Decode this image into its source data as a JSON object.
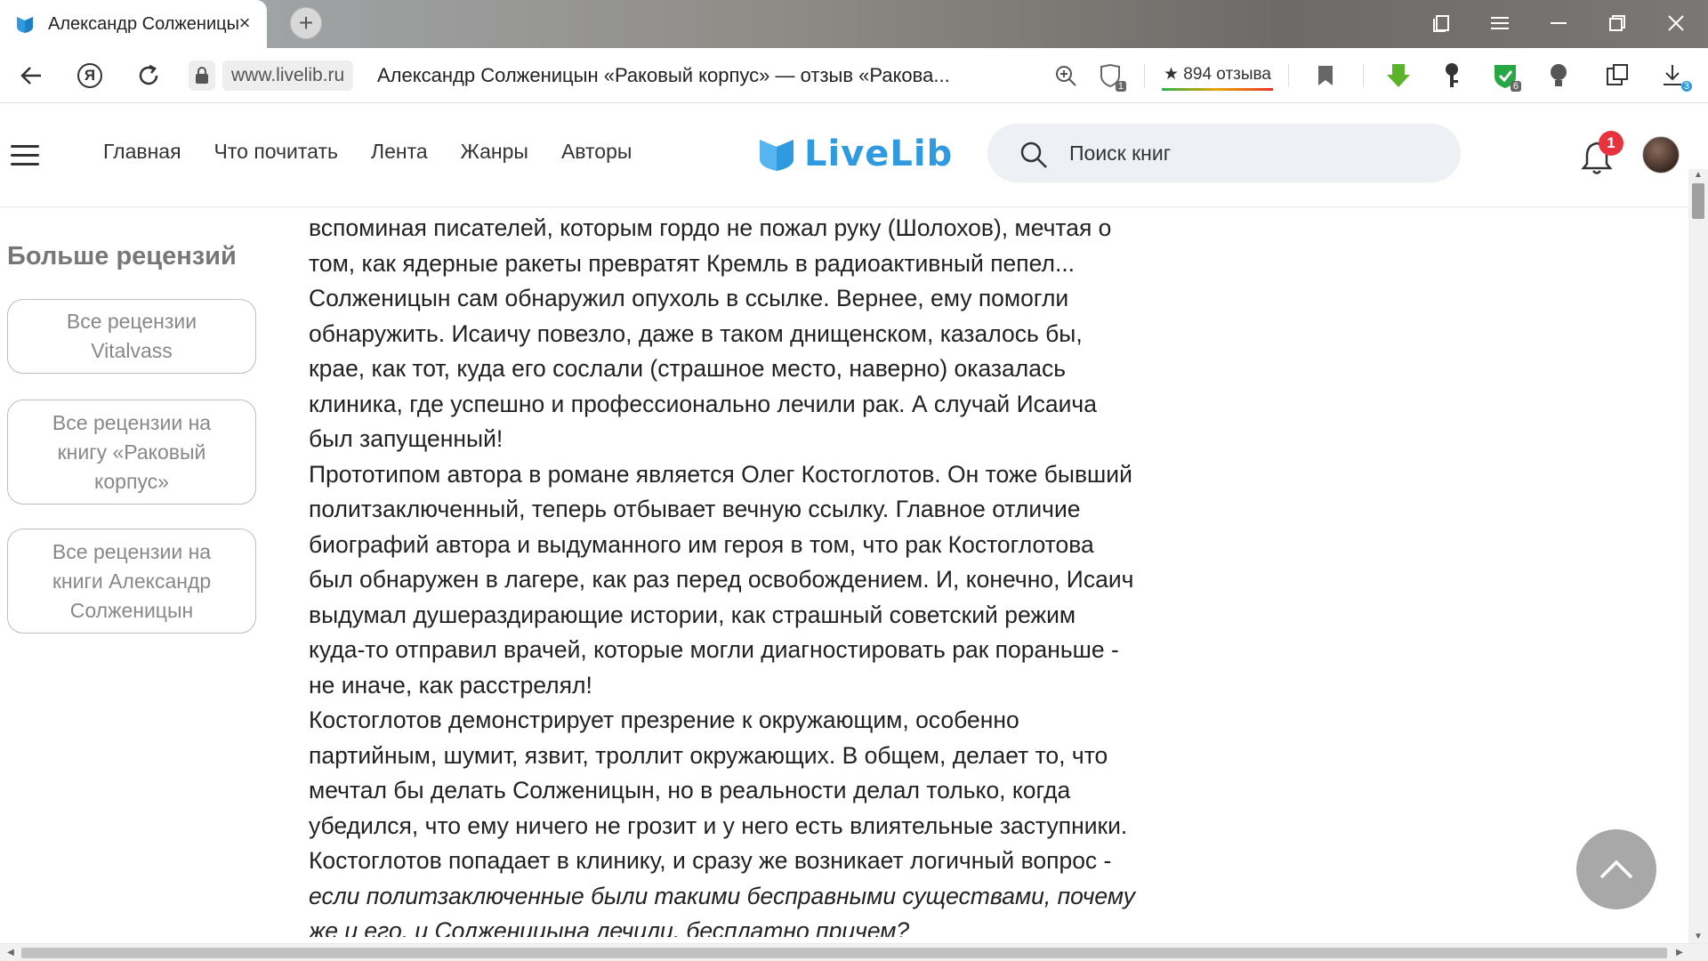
{
  "browser": {
    "tab_title": "Александр Солженицын",
    "tab_close": "×",
    "new_tab": "+",
    "url_domain": "www.livelib.ru",
    "url_title": "Александр Солженицын «Раковый корпус» — отзыв «Ракова...",
    "reviews_chip": "★ 894 отзыва",
    "ext_badge_1": "1",
    "ext_badge_6": "6",
    "ext_badge_3": "3",
    "yandex_label": "Я"
  },
  "site": {
    "nav": [
      "Главная",
      "Что почитать",
      "Лента",
      "Жанры",
      "Авторы"
    ],
    "logo_text": "LiveLib",
    "search_placeholder": "Поиск книг",
    "notifications_count": "1",
    "accent": "#2f9ae0",
    "badge_color": "#e8323e"
  },
  "sidebar": {
    "title": "Больше рецензий",
    "buttons": [
      "Все рецензии Vitalvass",
      "Все рецензии на книгу «Раковый корпус»",
      "Все рецензии на книги Александр Солженицын"
    ]
  },
  "article": {
    "lines": [
      "вспоминая писателей, которым гордо не пожал руку (Шолохов), мечтая о",
      "том, как ядерные ракеты превратят Кремль в радиоактивный пепел...",
      "Солженицын сам обнаружил опухоль в ссылке. Вернее, ему помогли",
      "обнаружить. Исаичу повезло, даже в таком днищенском, казалось бы,",
      "крае, как тот, куда его сослали (страшное место, наверно) оказалась",
      "клиника, где успешно и профессионально лечили рак. А случай Исаича",
      "был запущенный!",
      "Прототипом автора в романе является Олег Костоглотов. Он тоже бывший",
      "политзаключенный, теперь отбывает вечную ссылку. Главное отличие",
      "биографий автора и выдуманного им героя в том, что рак Костоглотова",
      "был обнаружен в лагере, как раз перед освобождением. И, конечно, Исаич",
      "выдумал душераздирающие истории, как страшный советский режим",
      "куда-то отправил врачей, которые могли диагностировать рак пораньше -",
      "не иначе, как расстрелял!",
      "Костоглотов демонстрирует презрение к окружающим, особенно",
      "партийным, шумит, язвит, троллит окружающих. В общем, делает то, что",
      "мечтал бы делать Солженицын, но в реальности делал только, когда",
      "убедился, что ему ничего не грозит и у него есть влиятельные заступники.",
      "Костоглотов попадает в клинику, и сразу же возникает логичный вопрос -"
    ],
    "italic_lines": [
      "если политзаключенные были такими бесправными существами, почему",
      "же и его, и Солженицына лечили, бесплатно причем?"
    ]
  }
}
